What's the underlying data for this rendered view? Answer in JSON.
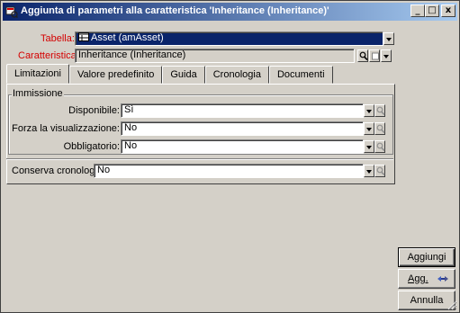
{
  "window": {
    "title": "Aggiunta di parametri alla caratteristica 'Inheritance (Inheritance)'",
    "controls": {
      "minimize": "_",
      "maximize": "□",
      "close": "x"
    }
  },
  "form": {
    "tabella": {
      "label": "Tabella:",
      "value": "Asset (amAsset)"
    },
    "caratteristica": {
      "label": "Caratteristica:",
      "value": "Inheritance (Inheritance)"
    }
  },
  "tabs": [
    {
      "label": "Limitazioni",
      "active": true
    },
    {
      "label": "Valore predefinito",
      "active": false
    },
    {
      "label": "Guida",
      "active": false
    },
    {
      "label": "Cronologia",
      "active": false
    },
    {
      "label": "Documenti",
      "active": false
    }
  ],
  "immissione": {
    "label": "Immissione",
    "disponibile": {
      "label": "Disponibile:",
      "value": "Sì"
    },
    "forza": {
      "label": "Forza la visualizzazione:",
      "value": "No"
    },
    "obbligatorio": {
      "label": "Obbligatorio:",
      "value": "No"
    }
  },
  "conserva": {
    "label": "Conserva cronologia:",
    "value": "No"
  },
  "buttons": {
    "aggiungi": "Aggiungi",
    "agg": "Agg.",
    "annulla": "Annulla"
  },
  "colors": {
    "title_active": "#0a246a",
    "required_label": "#d40000",
    "face": "#d4d0c8"
  }
}
